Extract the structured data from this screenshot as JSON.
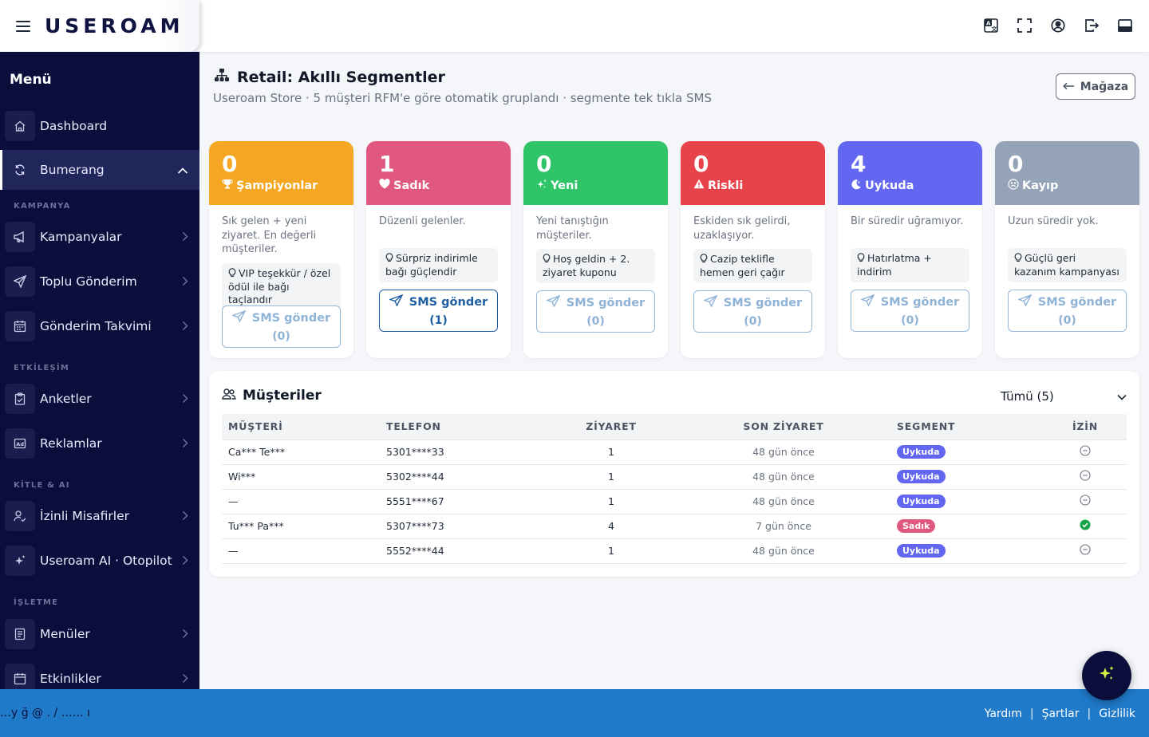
{
  "brand": {
    "logo": "USEROAM"
  },
  "topbar": {
    "icons": [
      "translate-icon",
      "fullscreen-icon",
      "user-circle-icon",
      "logout-icon",
      "panel-icon"
    ]
  },
  "sidebar": {
    "title": "Menü",
    "dashboard": "Dashboard",
    "bumerang": "Bumerang",
    "sections": {
      "kampanya": "KAMPANYA",
      "etkilesim": "ETKİLEŞİM",
      "kitle": "KİTLE & AI",
      "isletme": "İŞLETME"
    },
    "items": {
      "kampanyalar": "Kampanyalar",
      "toplu": "Toplu Gönderim",
      "takvim": "Gönderim Takvimi",
      "anketler": "Anketler",
      "reklamlar": "Reklamlar",
      "izinli": "İzinli Misafirler",
      "ai": "Useroam AI · Otopilot",
      "menuler": "Menüler",
      "etkinlikler": "Etkinlikler"
    }
  },
  "page": {
    "title": "Retail: Akıllı Segmentler",
    "subtitle": "Useroam Store · 5 müşteri RFM'e göre otomatik gruplandı · segmente tek tıkla SMS",
    "back_label": "Mağaza"
  },
  "segments": [
    {
      "count": "0",
      "name": "Şampiyonlar",
      "color": "#f5a623",
      "desc": "Sık gelen + yeni ziyaret. En değerli müşteriler.",
      "tip": "VIP teşekkür / özel ödül ile bağı taçlandır",
      "sms": "SMS gönder",
      "sms_count": "(0)"
    },
    {
      "count": "1",
      "name": "Sadık",
      "color": "#e0577f",
      "desc": "Düzenli gelenler.",
      "tip": "Sürpriz indirimle bağı güçlendir",
      "sms": "SMS gönder",
      "sms_count": "(1)"
    },
    {
      "count": "0",
      "name": "Yeni",
      "color": "#2fc467",
      "desc": "Yeni tanıştığın müşteriler.",
      "tip": "Hoş geldin + 2. ziyaret kuponu",
      "sms": "SMS gönder",
      "sms_count": "(0)"
    },
    {
      "count": "0",
      "name": "Riskli",
      "color": "#e8424a",
      "desc": "Eskiden sık gelirdi, uzaklaşıyor.",
      "tip": "Cazip teklifle hemen geri çağır",
      "sms": "SMS gönder",
      "sms_count": "(0)"
    },
    {
      "count": "4",
      "name": "Uykuda",
      "color": "#6366f1",
      "desc": "Bir süredir uğramıyor.",
      "tip": "Hatırlatma + indirim",
      "sms": "SMS gönder",
      "sms_count": "(0)"
    },
    {
      "count": "0",
      "name": "Kayıp",
      "color": "#94a3b8",
      "desc": "Uzun süredir yok.",
      "tip": "Güçlü geri kazanım kampanyası",
      "sms": "SMS gönder",
      "sms_count": "(0)"
    }
  ],
  "customers": {
    "title": "Müşteriler",
    "filter": "Tümü (5)",
    "columns": [
      "MÜŞTERİ",
      "TELEFON",
      "ZİYARET",
      "SON ZİYARET",
      "SEGMENT",
      "İZİN"
    ],
    "rows": [
      {
        "name": "Ca*** Te***",
        "phone": "5301****33",
        "visits": "1",
        "last": "48 gün önce",
        "segment": "Uykuda",
        "seg_color": "#6366f1",
        "consent": false
      },
      {
        "name": "Wi***",
        "phone": "5302****44",
        "visits": "1",
        "last": "48 gün önce",
        "segment": "Uykuda",
        "seg_color": "#6366f1",
        "consent": false
      },
      {
        "name": "—",
        "phone": "5551****67",
        "visits": "1",
        "last": "48 gün önce",
        "segment": "Uykuda",
        "seg_color": "#6366f1",
        "consent": false
      },
      {
        "name": "Tu*** Pa***",
        "phone": "5307****73",
        "visits": "4",
        "last": "7 gün önce",
        "segment": "Sadık",
        "seg_color": "#e0577f",
        "consent": true
      },
      {
        "name": "—",
        "phone": "5552****44",
        "visits": "1",
        "last": "48 gün önce",
        "segment": "Uykuda",
        "seg_color": "#6366f1",
        "consent": false
      }
    ]
  },
  "footer": {
    "links": [
      "Yardım",
      "Şartlar",
      "Gizlilik"
    ],
    "left_text": "…y ğ @ . / …… ı"
  }
}
